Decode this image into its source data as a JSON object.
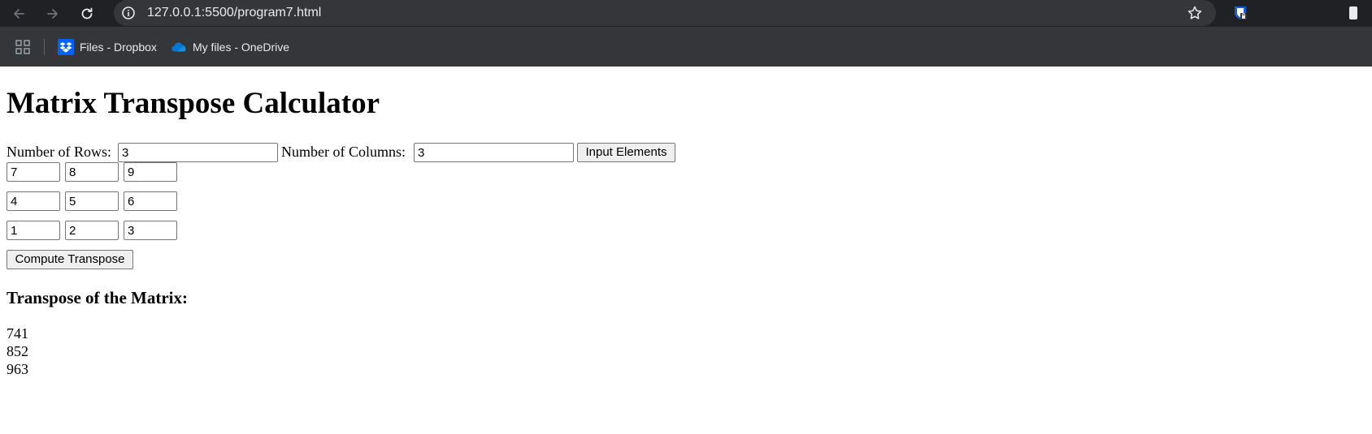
{
  "browser": {
    "url": "127.0.0.1:5500/program7.html",
    "icons": {
      "back": "arrow-left-icon",
      "forward": "arrow-right-icon",
      "reload": "reload-icon",
      "info": "info-icon",
      "bookmark": "star-icon",
      "extension": "bitwarden-icon",
      "apps": "apps-grid-icon"
    },
    "bookmarks": [
      {
        "label": "Files - Dropbox",
        "icon": "dropbox-icon",
        "color": "#0061fe"
      },
      {
        "label": "My files - OneDrive",
        "icon": "onedrive-icon",
        "color": "#0078d4"
      }
    ]
  },
  "page": {
    "title": "Matrix Transpose Calculator",
    "rows_label": "Number of Rows:",
    "rows_value": "3",
    "cols_label": "Number of Columns:",
    "cols_value": "3",
    "input_elements_button": "Input Elements",
    "matrix": [
      [
        "7",
        "8",
        "9"
      ],
      [
        "4",
        "5",
        "6"
      ],
      [
        "1",
        "2",
        "3"
      ]
    ],
    "compute_button": "Compute Transpose",
    "result_heading": "Transpose of the Matrix:",
    "result_lines": [
      "741",
      "852",
      "963"
    ]
  }
}
